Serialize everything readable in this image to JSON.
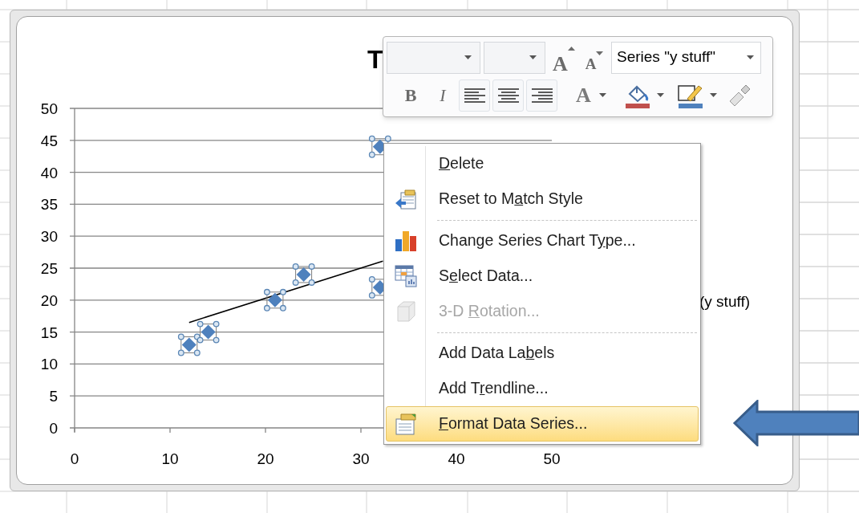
{
  "chart": {
    "title": "T",
    "legend": "(y stuff)",
    "chart_data": {
      "type": "scatter",
      "x": [
        12,
        14,
        21,
        24,
        32,
        32
      ],
      "series": [
        {
          "color": "#4f81bd",
          "values": [
            13,
            15,
            20,
            24,
            22,
            44
          ]
        },
        {
          "type": "line",
          "color": "#000000",
          "x": [
            12,
            32.3
          ],
          "values": [
            16.5,
            26.1
          ]
        }
      ],
      "grid": true,
      "xlim": [
        0,
        50
      ],
      "ylim": [
        0,
        50
      ],
      "xticks": [
        0,
        10,
        20,
        30,
        40,
        50
      ],
      "yticks": [
        0,
        5,
        10,
        15,
        20,
        25,
        30,
        35,
        40,
        45,
        50
      ]
    },
    "series_selected": true
  },
  "mini_toolbar": {
    "series_box": {
      "value": "Series \"y stuff\""
    },
    "buttons": [
      {
        "kind": "grow_font",
        "glyph": "A"
      },
      {
        "kind": "shrink_font",
        "glyph": "A"
      },
      {
        "kind": "bold",
        "glyph": "B"
      },
      {
        "kind": "italic",
        "glyph": "I"
      },
      {
        "kind": "align_left"
      },
      {
        "kind": "align_center"
      },
      {
        "kind": "align_right"
      },
      {
        "kind": "font_color",
        "glyph": "A"
      },
      {
        "kind": "fill_color",
        "color": "#c0504d"
      },
      {
        "kind": "line_color",
        "color": "#4f81bd"
      },
      {
        "kind": "format_painter"
      }
    ]
  },
  "context_menu": [
    {
      "kind": "item",
      "key": "D",
      "post": "elete",
      "disabled": false,
      "selected": false
    },
    {
      "kind": "item",
      "pre": "Reset to M",
      "key": "a",
      "post": "tch Style",
      "disabled": false,
      "selected": false
    },
    {
      "kind": "separator"
    },
    {
      "kind": "item",
      "pre": "Change Series Chart T",
      "key": "y",
      "post": "pe...",
      "disabled": false,
      "selected": false
    },
    {
      "kind": "item",
      "pre": "S",
      "key": "e",
      "post": "lect Data...",
      "disabled": false,
      "selected": false
    },
    {
      "kind": "item",
      "pre": "3-D ",
      "key": "R",
      "post": "otation...",
      "disabled": true,
      "selected": false
    },
    {
      "kind": "separator"
    },
    {
      "kind": "item",
      "pre": "Add Data La",
      "key": "b",
      "post": "els",
      "disabled": false,
      "selected": false
    },
    {
      "kind": "item",
      "pre": "Add T",
      "key": "r",
      "post": "endline...",
      "disabled": false,
      "selected": false
    },
    {
      "kind": "item",
      "key": "F",
      "post": "ormat Data Series...",
      "disabled": false,
      "selected": true
    }
  ]
}
